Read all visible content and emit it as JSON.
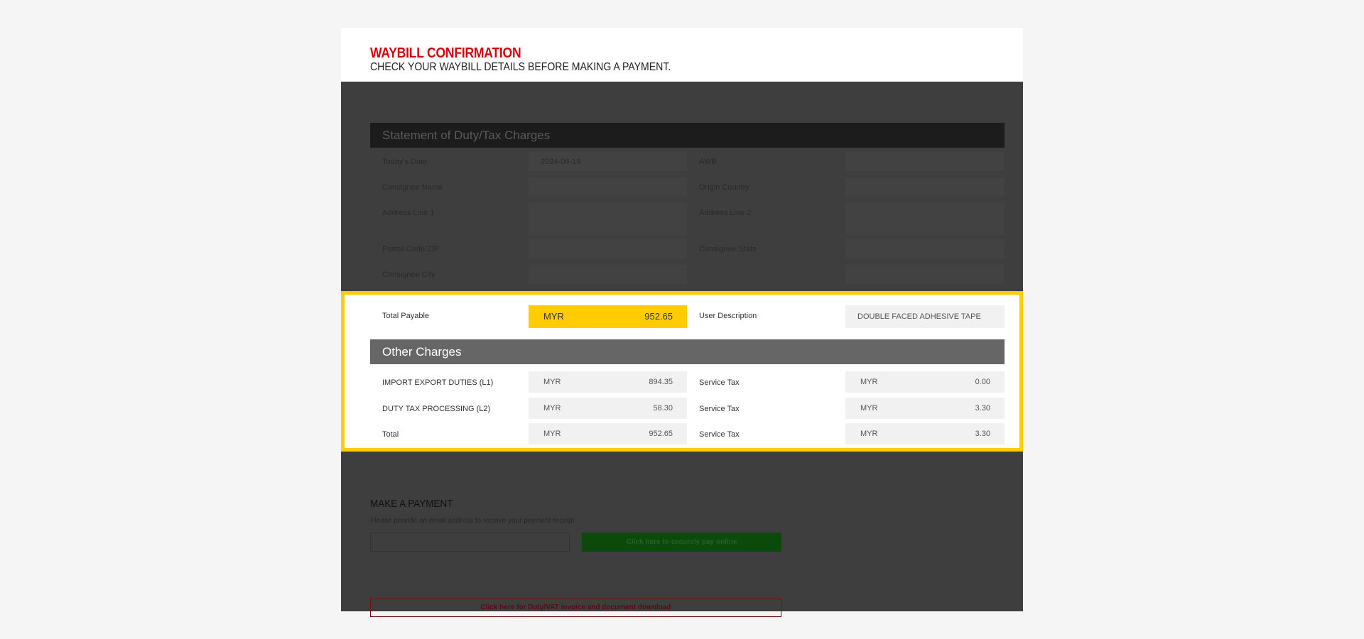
{
  "header": {
    "title": "WAYBILL CONFIRMATION",
    "subtitle": "CHECK YOUR WAYBILL DETAILS BEFORE MAKING A PAYMENT."
  },
  "statement": {
    "title": "Statement of Duty/Tax Charges",
    "todays_date_label": "Today's Date",
    "todays_date_value": "2024-06-19",
    "awb_label": "AWB",
    "awb_value": "",
    "consignee_name_label": "Consignee Name",
    "consignee_name_value": "",
    "origin_country_label": "Origin Country",
    "origin_country_value": "",
    "address1_label": "Address Line 1",
    "address1_value": "",
    "address2_label": "Address Line 2",
    "address2_value": "",
    "postal_label": "Postal Code/ZIP",
    "postal_value": "",
    "state_label": "Consignee State",
    "state_value": "",
    "city_label": "Consignee City",
    "city_value": ""
  },
  "total_payable": {
    "label": "Total Payable",
    "currency": "MYR",
    "amount": "952.65",
    "user_description_label": "User Description",
    "user_description_value": "DOUBLE FACED ADHESIVE TAPE"
  },
  "other_charges": {
    "title": "Other Charges",
    "rows": [
      {
        "label": "IMPORT EXPORT DUTIES (L1)",
        "currency": "MYR",
        "amount": "894.35",
        "tax_label": "Service Tax",
        "tax_currency": "MYR",
        "tax_amount": "0.00"
      },
      {
        "label": "DUTY TAX PROCESSING (L2)",
        "currency": "MYR",
        "amount": "58.30",
        "tax_label": "Service Tax",
        "tax_currency": "MYR",
        "tax_amount": "3.30"
      },
      {
        "label": "Total",
        "currency": "MYR",
        "amount": "952.65",
        "tax_label": "Service Tax",
        "tax_currency": "MYR",
        "tax_amount": "3.30"
      }
    ]
  },
  "payment": {
    "title": "MAKE A PAYMENT",
    "hint": "Please provide an email address to receive your payment receipt",
    "email_value": "",
    "pay_button": "Click here to securely pay online",
    "invoice_button": "Click here for Duty/VAT invoice and document download"
  },
  "colors": {
    "brand_red": "#d40511",
    "highlight_yellow": "#ffcc00",
    "overlay": "#3e3e3e"
  }
}
